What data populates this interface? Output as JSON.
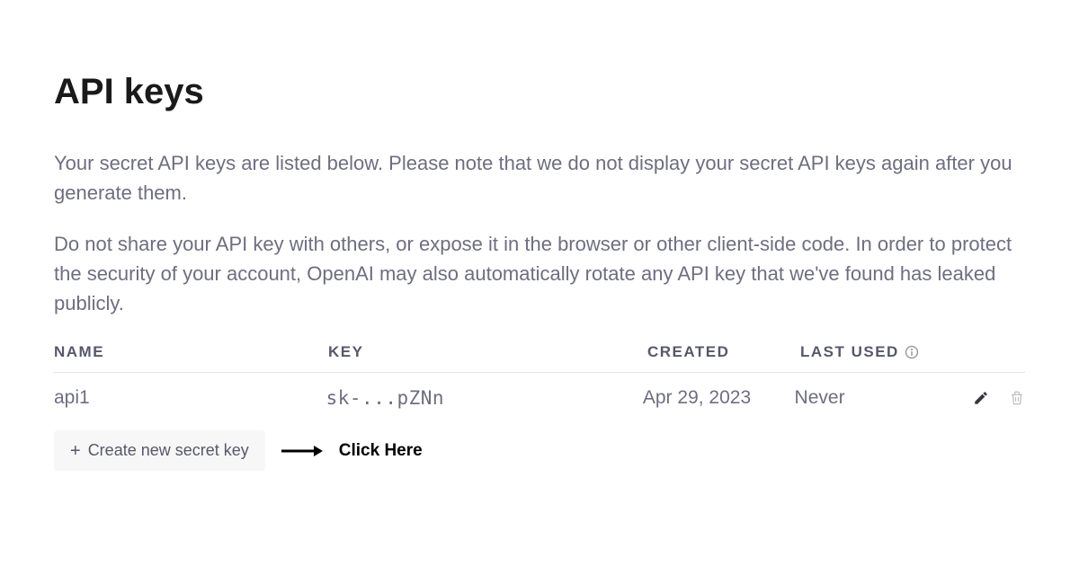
{
  "header": {
    "title": "API keys"
  },
  "descriptions": {
    "p1": "Your secret API keys are listed below. Please note that we do not display your secret API keys again after you generate them.",
    "p2": "Do not share your API key with others, or expose it in the browser or other client-side code. In order to protect the security of your account, OpenAI may also automatically rotate any API key that we've found has leaked publicly."
  },
  "table": {
    "columns": {
      "name": "NAME",
      "key": "KEY",
      "created": "CREATED",
      "last_used": "LAST USED"
    },
    "rows": [
      {
        "name": "api1",
        "key": "sk-...pZNn",
        "created": "Apr 29, 2023",
        "last_used": "Never"
      }
    ]
  },
  "actions": {
    "create_label": "Create new secret key"
  },
  "annotation": {
    "text": "Click Here"
  }
}
